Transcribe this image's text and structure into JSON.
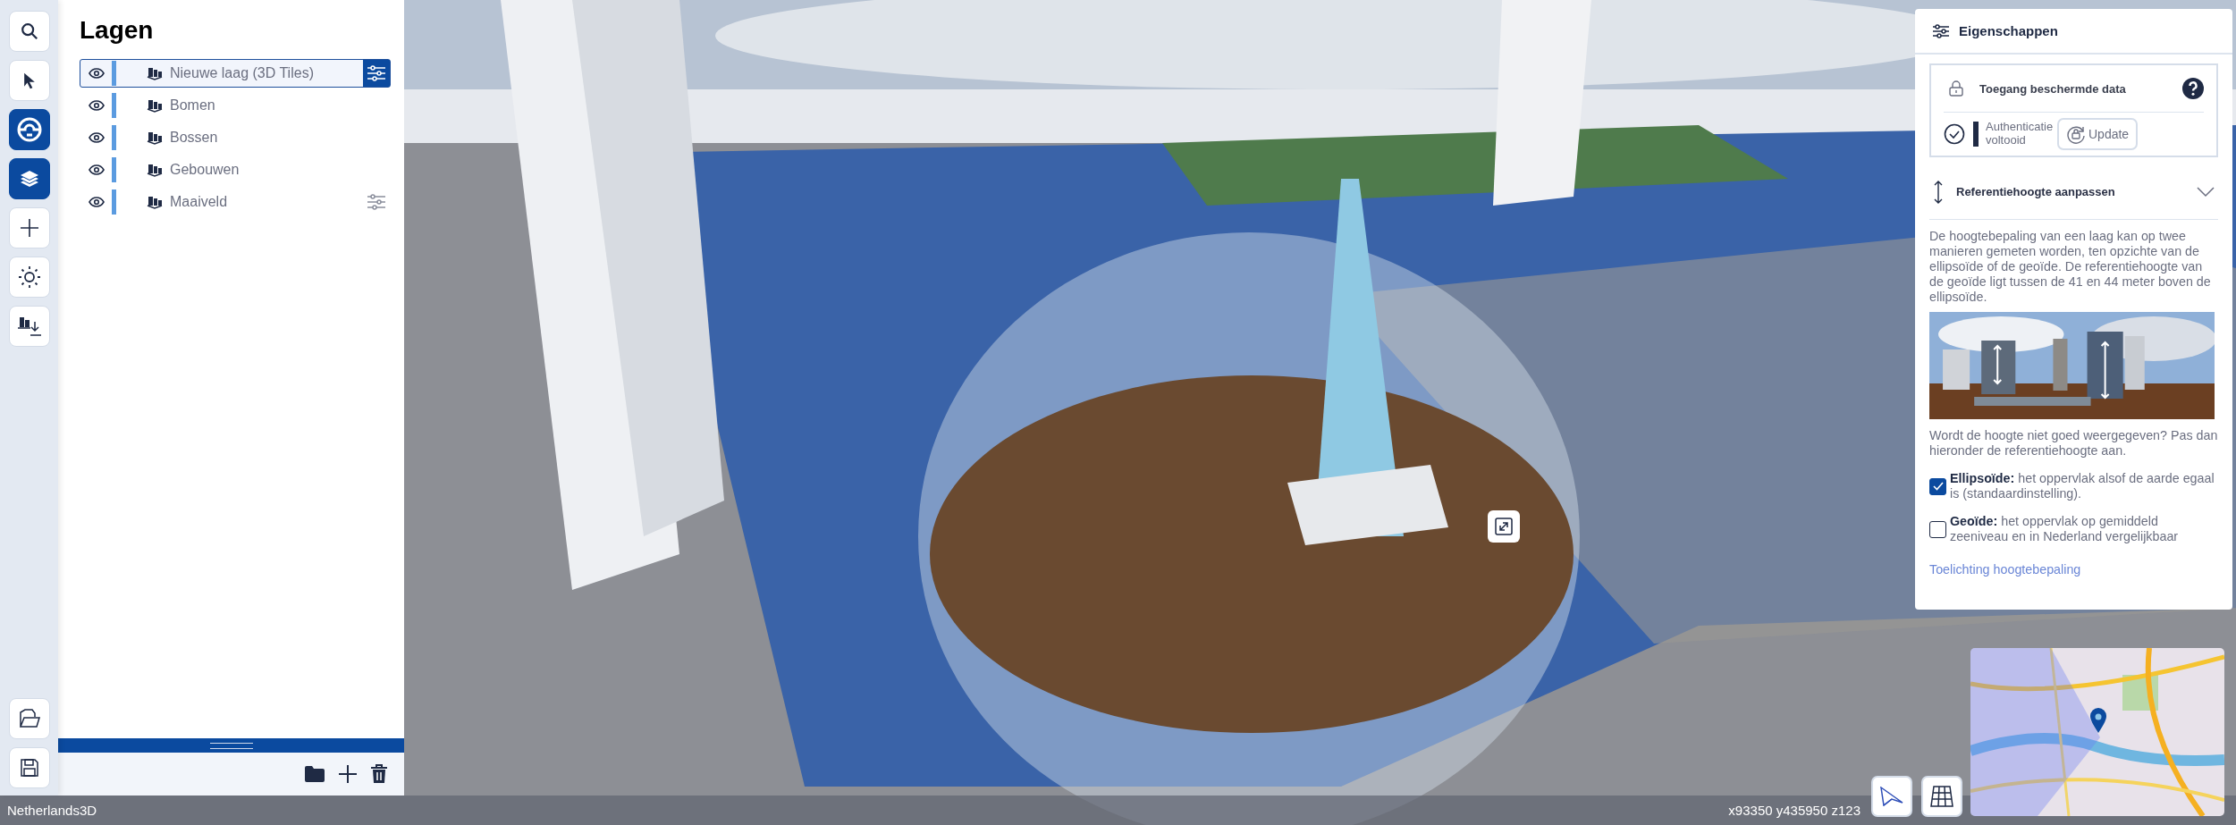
{
  "toolbar": {
    "top": [
      {
        "kind": "search",
        "selected": false
      },
      {
        "kind": "pointer",
        "selected": false
      },
      {
        "kind": "measure",
        "selected": true
      },
      {
        "kind": "layers",
        "selected": true
      },
      {
        "kind": "add",
        "selected": false
      },
      {
        "kind": "sun",
        "selected": false
      },
      {
        "kind": "import",
        "selected": false
      }
    ],
    "bottom": [
      {
        "kind": "open",
        "selected": false
      },
      {
        "kind": "save",
        "selected": false
      }
    ]
  },
  "layers_panel": {
    "title": "Lagen",
    "layers": [
      {
        "name": "Nieuwe laag (3D Tiles)",
        "selected": true,
        "settings": true
      },
      {
        "name": "Bomen",
        "selected": false,
        "settings": false
      },
      {
        "name": "Bossen",
        "selected": false,
        "settings": false
      },
      {
        "name": "Gebouwen",
        "selected": false,
        "settings": false
      },
      {
        "name": "Maaiveld",
        "selected": false,
        "settings": true
      }
    ]
  },
  "properties_panel": {
    "title": "Eigenschappen",
    "access": {
      "title": "Toegang beschermde data",
      "status": "Authenticatie voltooid",
      "button": "Update"
    },
    "reference": {
      "title": "Referentiehoogte aanpassen",
      "expanded": true,
      "intro": "De hoogtebepaling van een laag kan op twee manieren gemeten worden, ten opzichte van de ellipsoïde of de geoïde. De referentiehoogte van de geoïde ligt tussen de 41 en 44 meter boven de ellipsoïde.",
      "prompt": "Wordt de hoogte niet goed weergegeven? Pas dan hieronder de referentiehoogte aan.",
      "options": [
        {
          "text": "**Ellipsoïde:** het oppervlak alsof de aarde egaal is (standaardinstelling).",
          "checked": true
        },
        {
          "text": "**Geoïde:** het oppervlak op gemiddeld zeeniveau en in Nederland vergelijkbaar",
          "checked": false
        }
      ],
      "link": "Toelichting hoogtebepaling"
    }
  },
  "status_bar": {
    "app": "Netherlands3D",
    "coordinates": "x93350 y435950 z123"
  }
}
